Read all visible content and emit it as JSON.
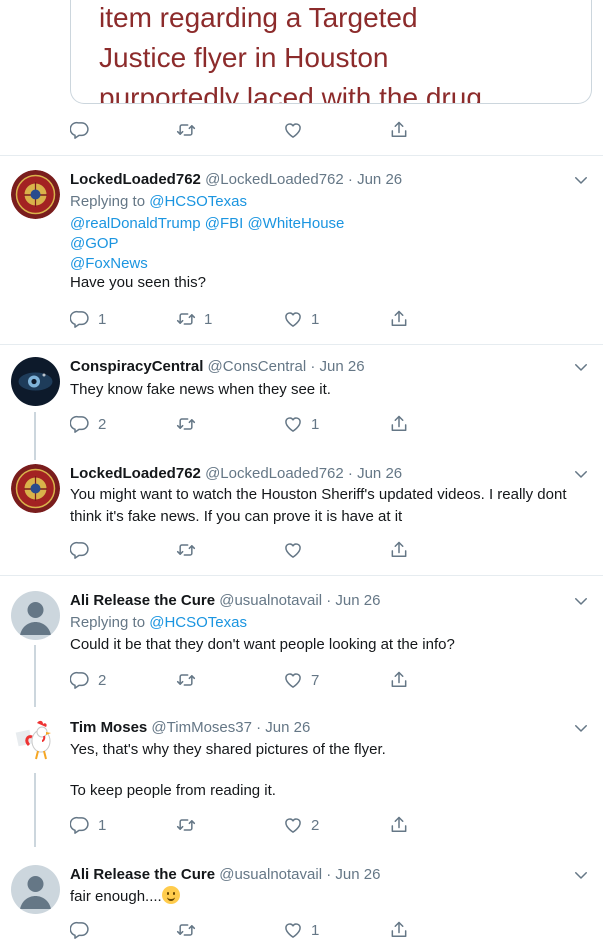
{
  "quote": {
    "lines": [
      "item regarding a Targeted",
      "Justice flyer in Houston",
      "purportedly laced with the drug"
    ]
  },
  "top_actions": {
    "reply": "",
    "retweet": "",
    "like": ""
  },
  "tweets": [
    {
      "name": "LockedLoaded762",
      "handle": "@LockedLoaded762",
      "date": "Jun 26",
      "replying_prefix": "Replying to",
      "replying_to": "@HCSOTexas",
      "mentions_line1": "@realDonaldTrump @FBI @WhiteHouse",
      "mentions_line2": "@GOP",
      "mentions_line3": "@FoxNews",
      "text": "Have you seen this?",
      "replies": "1",
      "retweets": "1",
      "likes": "1"
    },
    {
      "name": "ConspiracyCentral",
      "handle": "@ConsCentral",
      "date": "Jun 26",
      "text": "They know fake news when they see it.",
      "replies": "2",
      "retweets": "",
      "likes": "1"
    },
    {
      "name": "LockedLoaded762",
      "handle": "@LockedLoaded762",
      "date": "Jun 26",
      "text": "You might want to watch the Houston Sheriff's updated videos. I really dont think it's fake news. If you can prove it is have at it",
      "replies": "",
      "retweets": "",
      "likes": ""
    },
    {
      "name": "Ali Release the Cure",
      "handle": "@usualnotavail",
      "date": "Jun 26",
      "replying_prefix": "Replying to",
      "replying_to": "@HCSOTexas",
      "text": "Could it be that they don't want people looking at the info?",
      "replies": "2",
      "retweets": "",
      "likes": "7"
    },
    {
      "name": "Tim Moses",
      "handle": "@TimMoses37",
      "date": "Jun 26",
      "text": "Yes, that's why they shared pictures of the flyer.",
      "text2": "To keep people from reading it.",
      "replies": "1",
      "retweets": "",
      "likes": "2"
    },
    {
      "name": "Ali Release the Cure",
      "handle": "@usualnotavail",
      "date": "Jun 26",
      "text": "fair enough....",
      "replies": "",
      "retweets": "",
      "likes": "1"
    }
  ],
  "separator": "·",
  "icons": {
    "reply": "reply-icon",
    "retweet": "retweet-icon",
    "like": "like-icon",
    "share": "share-icon",
    "more": "chevron-down-icon",
    "emoji": "smiling-face-emoji"
  },
  "colors": {
    "link": "#1b95e0",
    "muted": "#657786",
    "quote_text": "#8c2b2b",
    "divider": "#e6ecf0"
  }
}
